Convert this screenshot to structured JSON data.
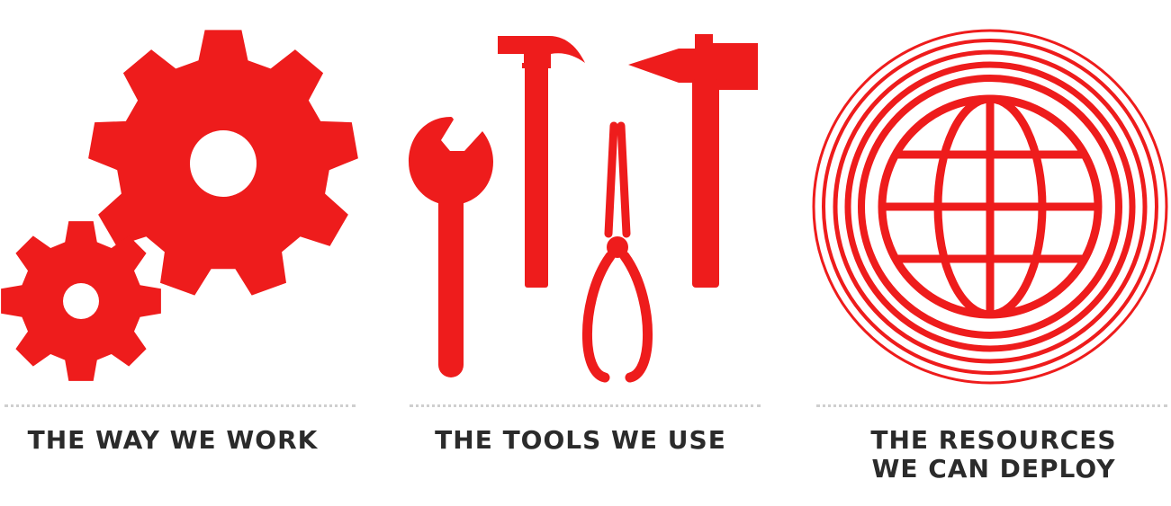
{
  "colors": {
    "accent": "#ee1c1c",
    "caption": "#2b2b2b",
    "divider": "#cfcfcf"
  },
  "panels": [
    {
      "icon": "gears-icon",
      "caption": "THE WAY WE WORK"
    },
    {
      "icon": "tools-icon",
      "caption": "THE TOOLS WE USE"
    },
    {
      "icon": "globe-icon",
      "caption": "THE RESOURCES\nWE CAN DEPLOY"
    }
  ]
}
